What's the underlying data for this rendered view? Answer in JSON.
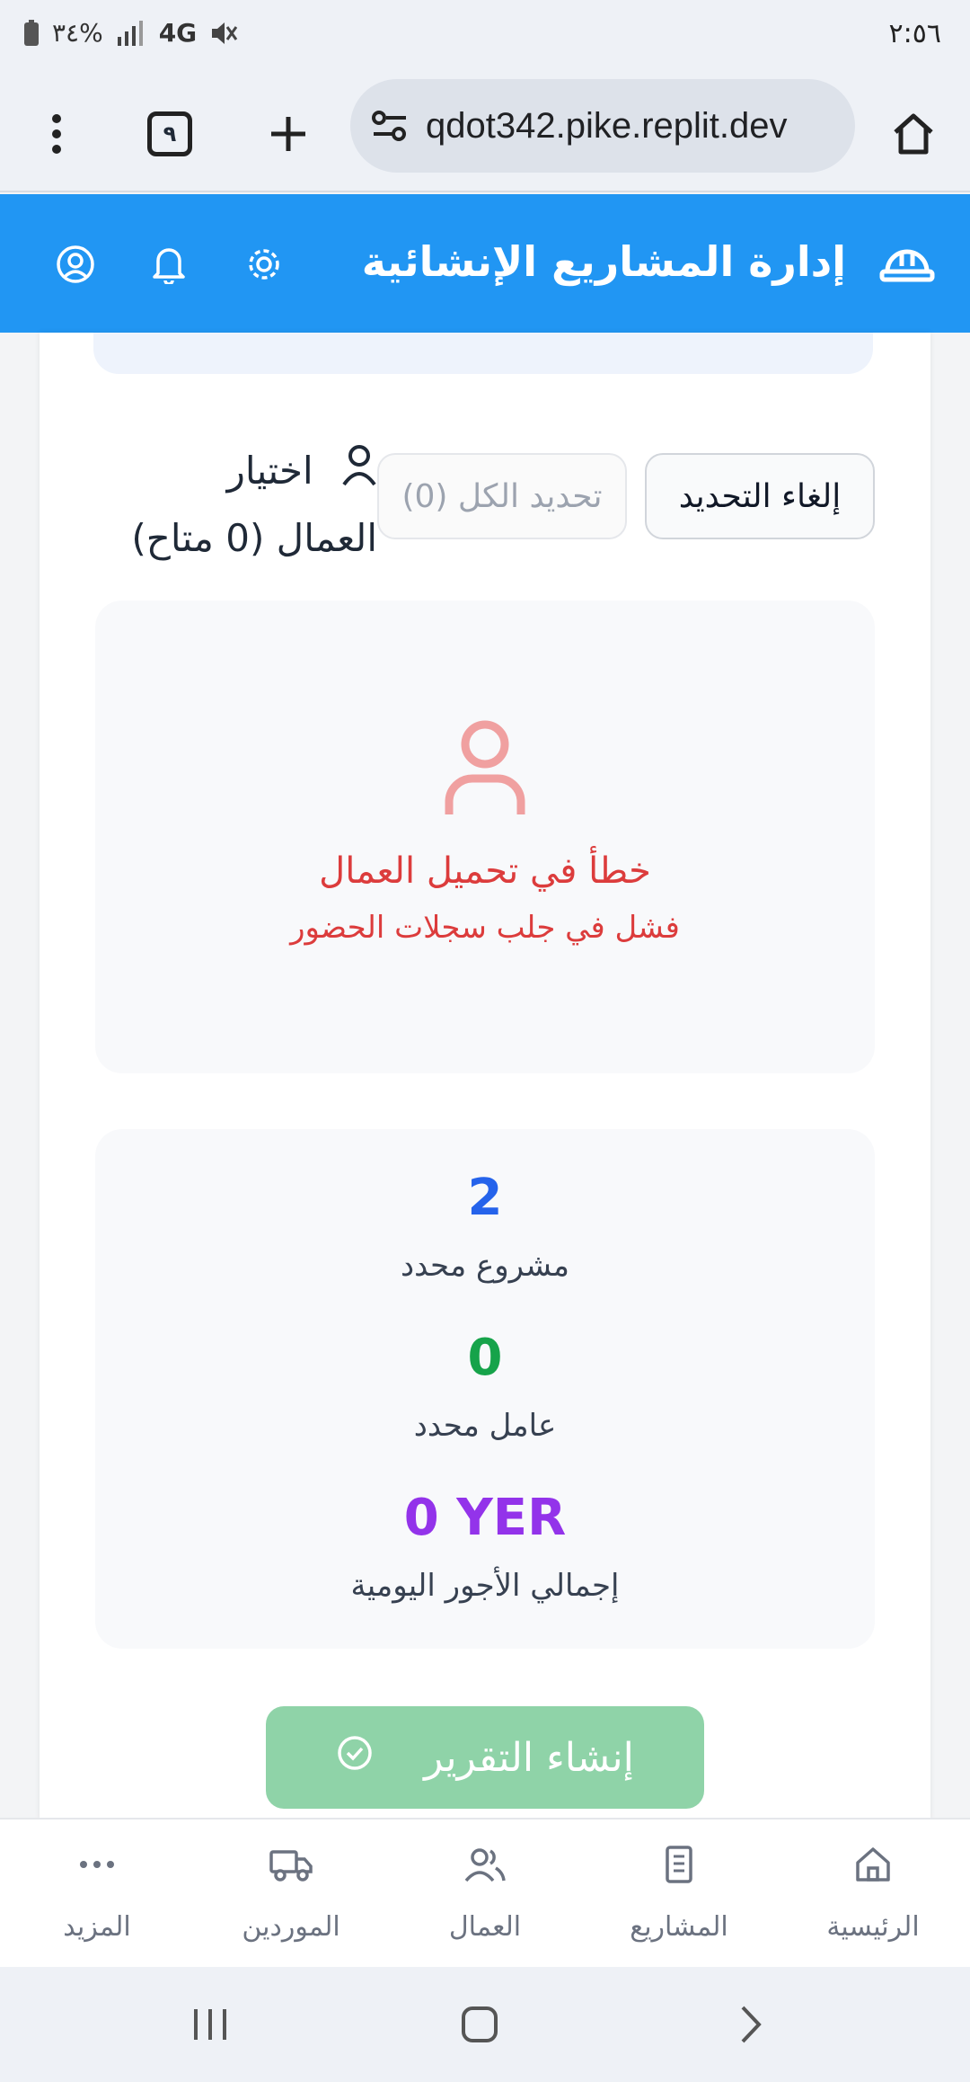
{
  "status_bar": {
    "time": "٢:٥٦",
    "battery": "٣٤%",
    "network": "4G"
  },
  "browser": {
    "url": "qdot342.pike.replit.dev",
    "tab_count": "٩"
  },
  "header": {
    "title": "إدارة المشاريع الإنشائية",
    "accent_color": "#2196f3"
  },
  "workers_section": {
    "title_line1": "اختيار",
    "title_line2": "العمال (0 متاح)",
    "clear_selection_label": "إلغاء التحديد",
    "select_all_label": "تحديد الكل (0)"
  },
  "error": {
    "title": "خطأ في تحميل العمال",
    "message": "فشل في جلب سجلات الحضور",
    "color": "#dc3c3c"
  },
  "summary": {
    "projects_value": "2",
    "projects_label": "مشروع محدد",
    "workers_value": "0",
    "workers_label": "عامل محدد",
    "wages_value": "0 YER",
    "wages_label": "إجمالي الأجور اليومية"
  },
  "report_button": {
    "label": "إنشاء التقرير"
  },
  "bottom_nav": {
    "items": [
      {
        "label": "الرئيسية",
        "icon": "home-icon"
      },
      {
        "label": "المشاريع",
        "icon": "building-icon"
      },
      {
        "label": "العمال",
        "icon": "users-icon"
      },
      {
        "label": "الموردين",
        "icon": "truck-icon"
      },
      {
        "label": "المزيد",
        "icon": "more-icon"
      }
    ]
  }
}
